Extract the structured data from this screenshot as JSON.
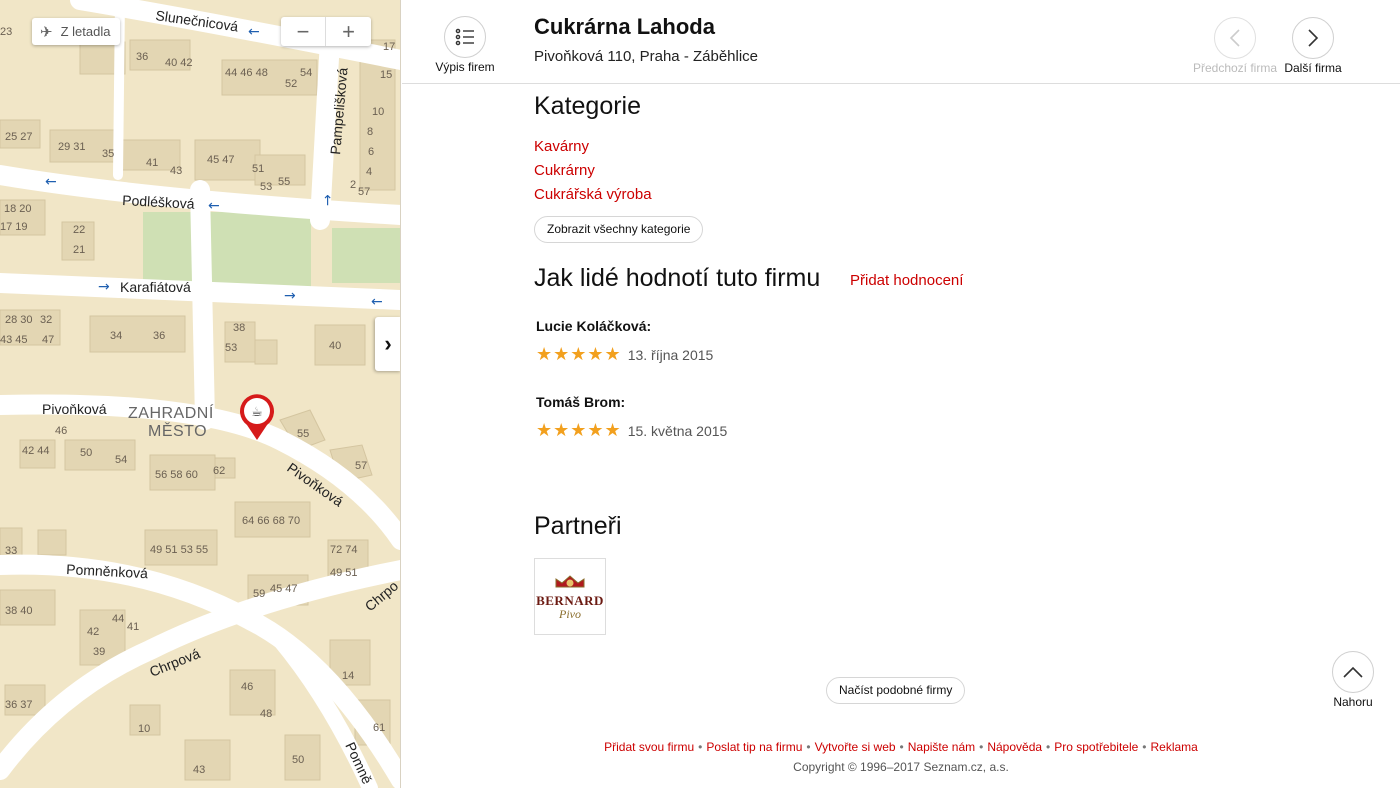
{
  "map": {
    "fly_label": "Z letadla",
    "zoom_out": "−",
    "zoom_in": "+",
    "collapse_icon": "›",
    "district": [
      "ZAHRADNÍ",
      "MĚSTO"
    ],
    "streets": {
      "slunecnicova": "Slunečnicová",
      "podleskova": "Podléšková",
      "karafiatova": "Karafiátová",
      "pivonkova_w": "Pivoňková",
      "pivonkova_e": "Pivoňková",
      "pampeliskova": "Pampelišková",
      "pomnenkova": "Pomněnková",
      "chrpova": "Chrpová",
      "chrpova_e": "Chrpo",
      "pomne": "Pomně"
    }
  },
  "header": {
    "list_label": "Výpis firem",
    "title": "Cukrárna Lahoda",
    "address": "Pivoňková 110, Praha - Záběhlice",
    "prev_label": "Předchozí firma",
    "next_label": "Další firma"
  },
  "categories": {
    "heading": "Kategorie",
    "items": [
      "Kavárny",
      "Cukrárny",
      "Cukrářská výroba"
    ],
    "show_all": "Zobrazit všechny kategorie"
  },
  "ratings": {
    "heading": "Jak lidé hodnotí tuto firmu",
    "add_label": "Přidat hodnocení",
    "reviews": [
      {
        "name": "Lucie Koláčková:",
        "stars": 5,
        "stars_text": "★★★★★",
        "date": "13. října 2015"
      },
      {
        "name": "Tomáš Brom:",
        "stars": 5,
        "stars_text": "★★★★★",
        "date": "15. května 2015"
      }
    ]
  },
  "partners": {
    "heading": "Partneři",
    "logo_text": [
      "BERNARD",
      "Pivo"
    ]
  },
  "load_similar": "Načíst podobné firmy",
  "top_label": "Nahoru",
  "footer": {
    "links": [
      "Přidat svou firmu",
      "Poslat tip na firmu",
      "Vytvořte si web",
      "Napište nám",
      "Nápověda",
      "Pro spotřebitele",
      "Reklama"
    ],
    "separator": "•",
    "copyright": "Copyright © 1996–2017 Seznam.cz, a.s."
  },
  "colors": {
    "link_red": "#cc0000",
    "star": "#f2a01e",
    "map_bg": "#f1e6c7",
    "building": "#e3d6b3",
    "park": "#cfe0b4"
  }
}
